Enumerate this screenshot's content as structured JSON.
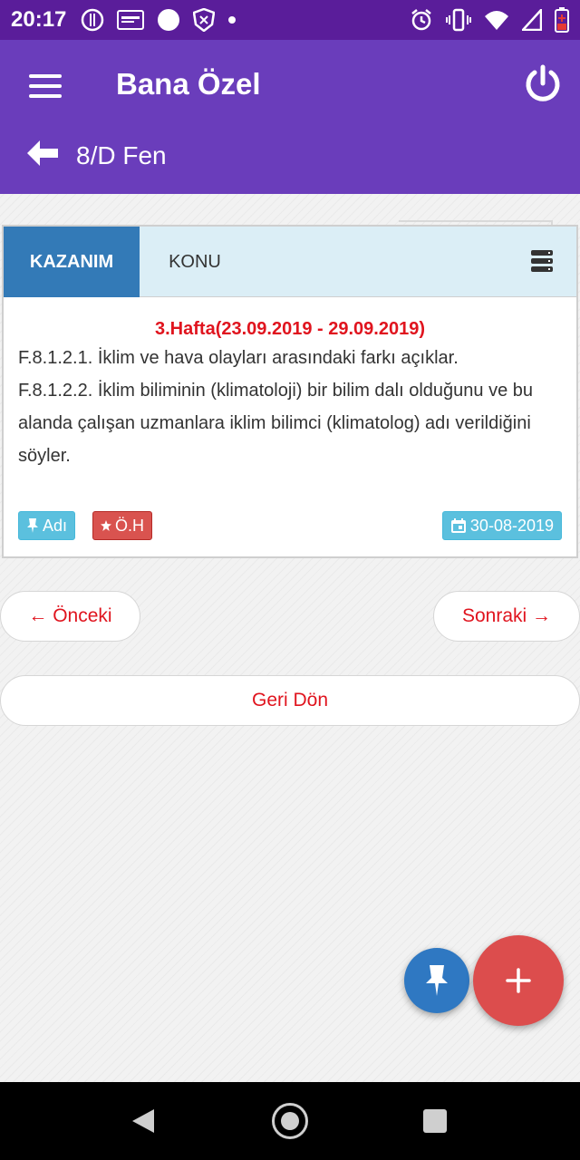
{
  "status_bar": {
    "time": "20:17",
    "icons_left": [
      "nfc-icon",
      "sim-icon",
      "circle-icon",
      "shield-icon",
      "dot-icon"
    ],
    "icons_right": [
      "alarm-icon",
      "vibrate-icon",
      "wifi-icon",
      "signal-icon",
      "battery-icon"
    ]
  },
  "app_bar": {
    "title": "Bana Özel",
    "subtitle": "8/D Fen",
    "color": "#6a3dbb"
  },
  "tabs": {
    "active": "KAZANIM",
    "other": "KONU"
  },
  "card": {
    "week": "3.Hafta(23.09.2019 - 29.09.2019)",
    "lines": [
      "F.8.1.2.1. İklim ve hava olayları arasındaki farkı açıklar.",
      "F.8.1.2.2. İklim biliminin (klimatoloji) bir bilim dalı olduğunu ve bu alanda çalışan uzmanlara iklim bilimci (klimatolog) adı verildiğini söyler."
    ],
    "badge_name": "Adı",
    "badge_oh": "Ö.H",
    "badge_date": "30-08-2019"
  },
  "buttons": {
    "prev": "← Önceki",
    "next": "Sonraki →",
    "back": "Geri Dön"
  },
  "colors": {
    "status": "#5a1d9a",
    "tab_active": "#337ab7",
    "accent_red": "#e0141e",
    "fab_pin": "#2f78c2",
    "fab_add": "#dc4d4d"
  }
}
